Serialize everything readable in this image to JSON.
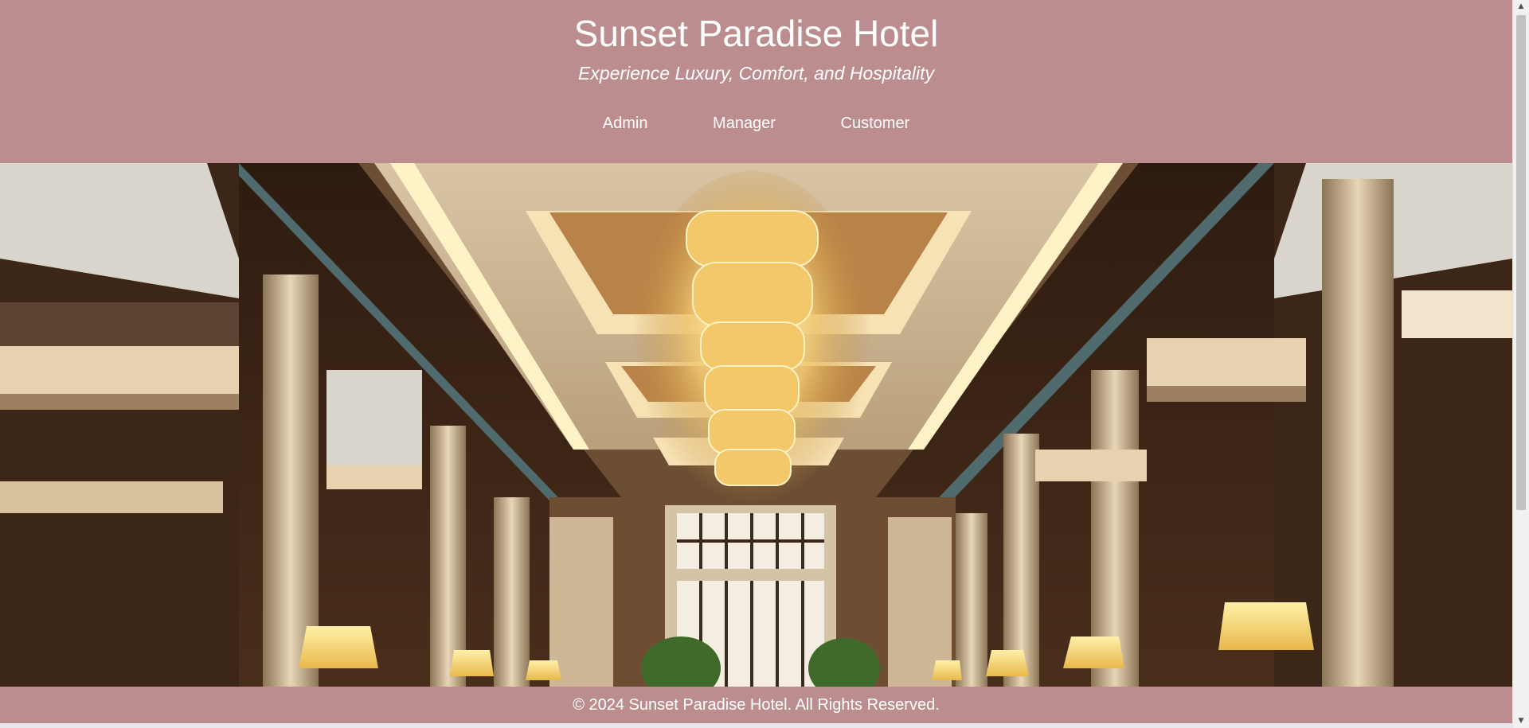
{
  "header": {
    "title": "Sunset Paradise Hotel",
    "tagline": "Experience Luxury, Comfort, and Hospitality"
  },
  "nav": {
    "items": [
      {
        "label": "Admin"
      },
      {
        "label": "Manager"
      },
      {
        "label": "Customer"
      }
    ]
  },
  "footer": {
    "text": "© 2024 Sunset Paradise Hotel. All Rights Reserved."
  },
  "colors": {
    "header_bg": "#bc8d8f",
    "text": "#ffffff",
    "hero_wood": "#3a2416",
    "hero_light": "#f3d9a0"
  },
  "scrollbar": {
    "up_icon": "arrow-up-icon",
    "down_icon": "arrow-down-icon"
  }
}
